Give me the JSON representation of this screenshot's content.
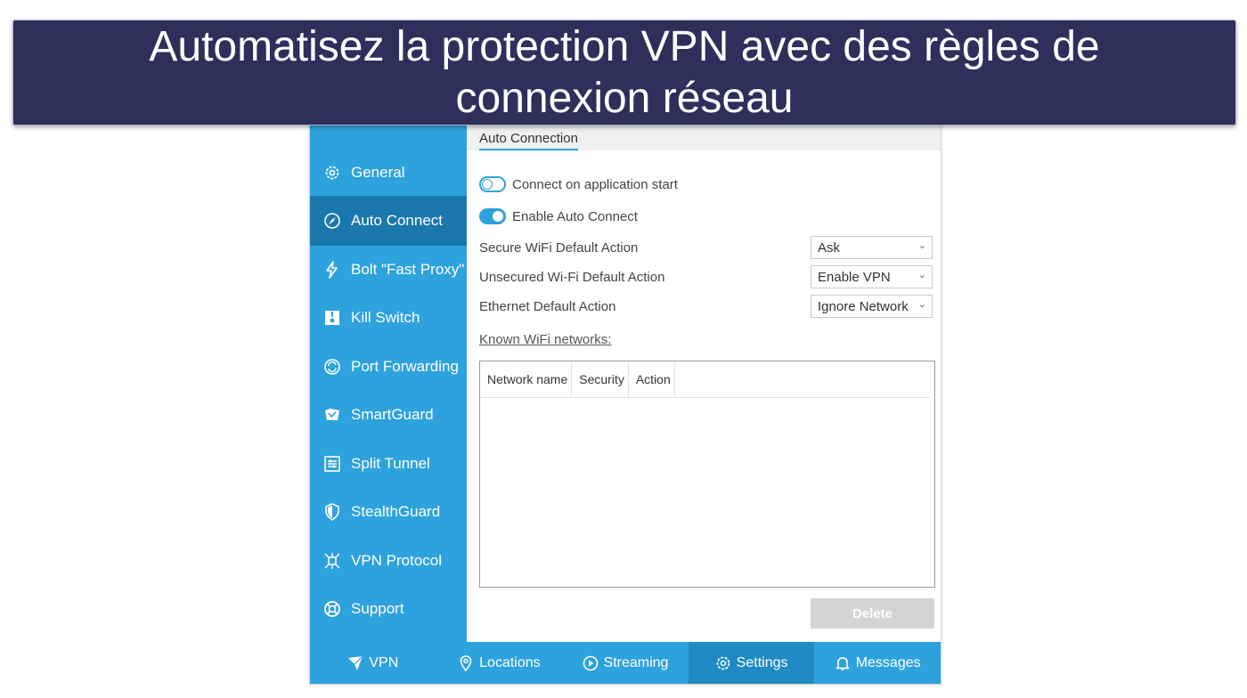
{
  "banner": {
    "title": "Automatisez la protection VPN avec des règles de connexion réseau"
  },
  "colors": {
    "accent": "#2ea2dc",
    "active": "#1a78ad",
    "banner_bg": "#2e2f5b"
  },
  "sidebar": {
    "items": [
      {
        "label": "General",
        "icon": "gear-icon"
      },
      {
        "label": "Auto Connect",
        "icon": "compass-icon",
        "active": true
      },
      {
        "label": "Bolt \"Fast Proxy\"",
        "icon": "bolt-icon"
      },
      {
        "label": "Kill Switch",
        "icon": "kill-switch-icon"
      },
      {
        "label": "Port Forwarding",
        "icon": "port-forwarding-icon"
      },
      {
        "label": "SmartGuard",
        "icon": "smartguard-icon"
      },
      {
        "label": "Split Tunnel",
        "icon": "split-tunnel-icon"
      },
      {
        "label": "StealthGuard",
        "icon": "shield-icon"
      },
      {
        "label": "VPN Protocol",
        "icon": "protocol-icon"
      },
      {
        "label": "Support",
        "icon": "lifebuoy-icon"
      }
    ]
  },
  "content": {
    "tab": "Auto Connection",
    "toggles": [
      {
        "label": "Connect on application start",
        "on": false
      },
      {
        "label": "Enable Auto Connect",
        "on": true
      }
    ],
    "settings": [
      {
        "label": "Secure WiFi Default Action",
        "value": "Ask"
      },
      {
        "label": "Unsecured Wi-Fi Default Action",
        "value": "Enable VPN"
      },
      {
        "label": "Ethernet Default Action",
        "value": "Ignore Network"
      }
    ],
    "known_label": "Known WiFi networks:",
    "table_headers": [
      "Network name",
      "Security",
      "Action"
    ],
    "delete_label": "Delete"
  },
  "bottom_nav": [
    {
      "label": "VPN",
      "icon": "vpn-icon"
    },
    {
      "label": "Locations",
      "icon": "location-pin-icon"
    },
    {
      "label": "Streaming",
      "icon": "play-icon"
    },
    {
      "label": "Settings",
      "icon": "gear-icon",
      "active": true
    },
    {
      "label": "Messages",
      "icon": "bell-icon"
    }
  ]
}
